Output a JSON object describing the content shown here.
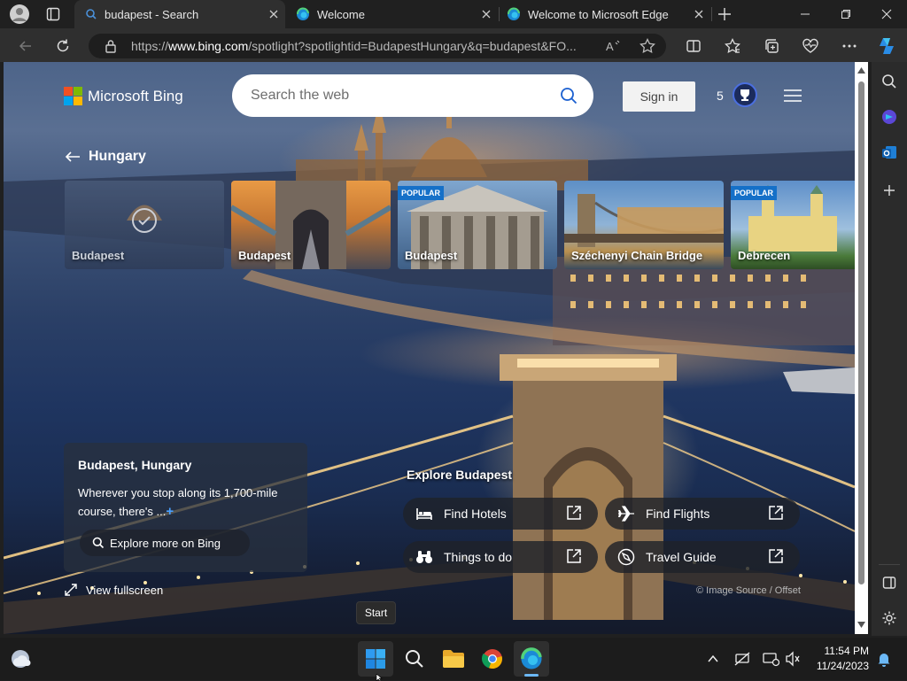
{
  "browser": {
    "tabs": [
      {
        "title": "budapest - Search",
        "active": true
      },
      {
        "title": "Welcome",
        "active": false
      },
      {
        "title": "Welcome to Microsoft Edge",
        "active": false
      }
    ],
    "url": {
      "prefix": "https://",
      "domain": "www.bing.com",
      "path": "/spotlight?spotlightid=BudapestHungary&q=budapest&FO..."
    }
  },
  "page": {
    "logo_text": "Microsoft Bing",
    "search_placeholder": "Search the web",
    "sign_in": "Sign in",
    "reward_points": "5",
    "back_label": "Hungary",
    "tiles": [
      {
        "label": "Budapest",
        "badge": "",
        "selected": true
      },
      {
        "label": "Budapest",
        "badge": ""
      },
      {
        "label": "Budapest",
        "badge": "POPULAR"
      },
      {
        "label": "Széchenyi Chain Bridge",
        "badge": ""
      },
      {
        "label": "Debrecen",
        "badge": "POPULAR"
      }
    ],
    "info": {
      "title": "Budapest, Hungary",
      "description": "Wherever you stop along its 1,700-mile course, there's ...",
      "expand": "+",
      "explore_button": "Explore more on Bing"
    },
    "view_fullscreen": "View fullscreen",
    "explore_heading": "Explore Budapest",
    "explore_links": [
      "Find Hotels",
      "Find Flights",
      "Things to do",
      "Travel Guide"
    ],
    "image_credit": "© Image Source / Offset"
  },
  "taskbar": {
    "tooltip": "Start",
    "time": "11:54 PM",
    "date": "11/24/2023"
  },
  "colors": {
    "accent": "#1570c8",
    "background": "#202020"
  }
}
